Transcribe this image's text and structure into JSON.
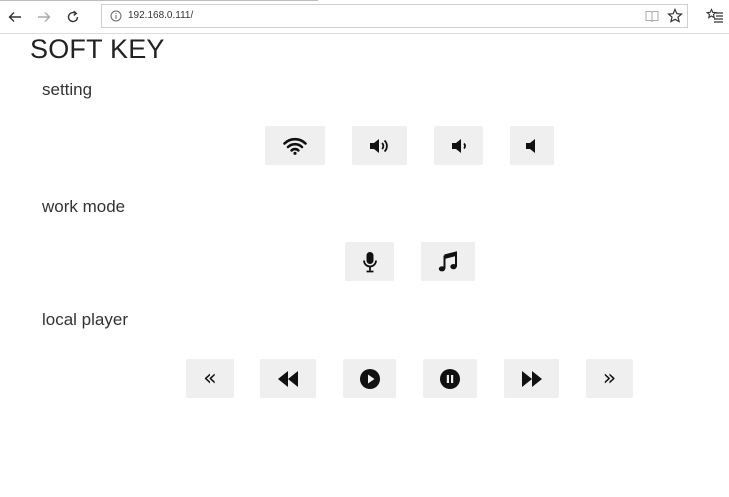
{
  "browser": {
    "url": "192.168.0.111/"
  },
  "page": {
    "title": "SOFT KEY"
  },
  "sections": {
    "setting": {
      "label": "setting"
    },
    "work_mode": {
      "label": "work mode"
    },
    "local_player": {
      "label": "local player"
    }
  },
  "glyphs": {
    "prev_track": "«",
    "next_track": "»"
  }
}
